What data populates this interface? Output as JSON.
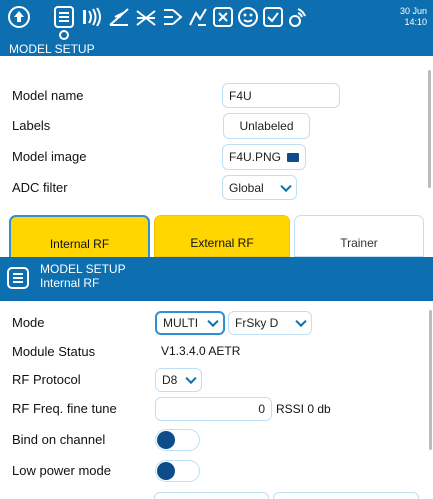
{
  "topbar": {
    "icons": [
      "radio-menu-icon",
      "model-menu-icon",
      "signal-icon",
      "curves-icon",
      "mixer-icon",
      "servo-icon",
      "flightmode-icon",
      "logical-switch-icon",
      "special-function-icon",
      "telemetry-icon",
      "checklist-icon",
      "script-icon"
    ],
    "date": "30 Jun",
    "time": "14:10"
  },
  "page_title": "MODEL SETUP",
  "model_setup": {
    "rows": [
      {
        "label": "Model name",
        "value": "F4U"
      },
      {
        "label": "Labels",
        "value": "Unlabeled"
      },
      {
        "label": "Model image",
        "value": "F4U.PNG"
      },
      {
        "label": "ADC filter",
        "value": "Global"
      }
    ]
  },
  "rf_tabs": [
    "Internal RF",
    "External RF",
    "Trainer"
  ],
  "internal_rf": {
    "header_title": "MODEL SETUP",
    "header_subtitle": "Internal RF",
    "mode": {
      "label": "Mode",
      "value": "MULTI",
      "sub_value": "FrSky D"
    },
    "module_status": {
      "label": "Module Status",
      "value": "V1.3.4.0 AETR"
    },
    "rf_protocol": {
      "label": "RF Protocol",
      "value": "D8"
    },
    "fine_tune": {
      "label": "RF Freq. fine tune",
      "value": "0",
      "rssi": "RSSI 0 db"
    },
    "bind_channel": {
      "label": "Bind on channel"
    },
    "low_power": {
      "label": "Low power mode"
    }
  },
  "colors": {
    "primary": "#0d6fb0",
    "tab_yellow": "#ffd600",
    "focus_border": "#2d8fd5",
    "toggle_knob": "#0d4c8a"
  }
}
